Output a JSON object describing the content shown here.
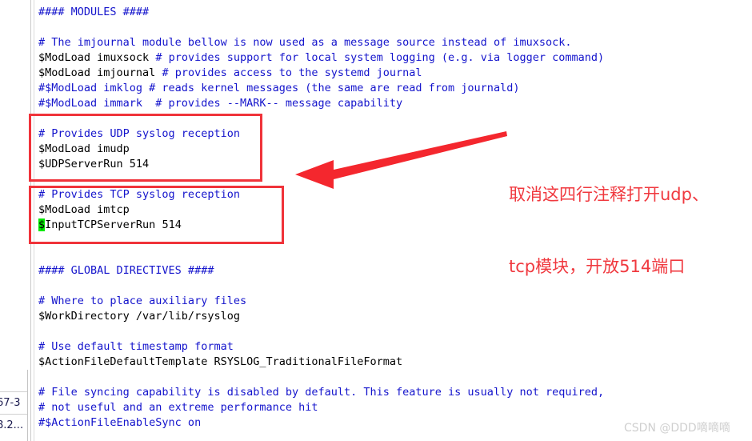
{
  "editor": {
    "file_type": "rsyslog.conf",
    "lines": [
      {
        "text": "#### MODULES ####",
        "kind": "comment"
      },
      {
        "text": "",
        "kind": "blank"
      },
      {
        "text": "# The imjournal module bellow is now used as a message source instead of imuxsock.",
        "kind": "comment"
      },
      {
        "text": "$ModLoad imuxsock # provides support for local system logging (e.g. via logger command)",
        "kind": "mixed",
        "code": "$ModLoad imuxsock ",
        "comment": "# provides support for local system logging (e.g. via logger command)"
      },
      {
        "text": "$ModLoad imjournal # provides access to the systemd journal",
        "kind": "mixed",
        "code": "$ModLoad imjournal ",
        "comment": "# provides access to the systemd journal"
      },
      {
        "text": "#$ModLoad imklog # reads kernel messages (the same are read from journald)",
        "kind": "comment"
      },
      {
        "text": "#$ModLoad immark  # provides --MARK-- message capability",
        "kind": "comment"
      },
      {
        "text": "",
        "kind": "blank"
      },
      {
        "text": "# Provides UDP syslog reception",
        "kind": "comment"
      },
      {
        "text": "$ModLoad imudp",
        "kind": "code"
      },
      {
        "text": "$UDPServerRun 514",
        "kind": "code"
      },
      {
        "text": "",
        "kind": "blank"
      },
      {
        "text": "# Provides TCP syslog reception",
        "kind": "comment"
      },
      {
        "text": "$ModLoad imtcp",
        "kind": "code"
      },
      {
        "text": "$InputTCPServerRun 514",
        "kind": "code-highlighted",
        "highlight_char": "$",
        "rest": "InputTCPServerRun 514"
      },
      {
        "text": "",
        "kind": "blank"
      },
      {
        "text": "",
        "kind": "blank"
      },
      {
        "text": "#### GLOBAL DIRECTIVES ####",
        "kind": "comment"
      },
      {
        "text": "",
        "kind": "blank"
      },
      {
        "text": "# Where to place auxiliary files",
        "kind": "comment"
      },
      {
        "text": "$WorkDirectory /var/lib/rsyslog",
        "kind": "code"
      },
      {
        "text": "",
        "kind": "blank"
      },
      {
        "text": "# Use default timestamp format",
        "kind": "comment"
      },
      {
        "text": "$ActionFileDefaultTemplate RSYSLOG_TraditionalFileFormat",
        "kind": "code"
      },
      {
        "text": "",
        "kind": "blank"
      },
      {
        "text": "# File syncing capability is disabled by default. This feature is usually not required,",
        "kind": "comment"
      },
      {
        "text": "# not useful and an extreme performance hit",
        "kind": "comment"
      },
      {
        "text": "#$ActionFileEnableSync on",
        "kind": "comment"
      }
    ],
    "colors": {
      "comment": "#1414cc",
      "directive": "#000000",
      "cursor_highlight": "#00e800",
      "background": "#ffffff"
    }
  },
  "annotations": {
    "box_udp": {
      "label": "Provides UDP syslog reception block",
      "color": "#f0333a"
    },
    "box_tcp": {
      "label": "Provides TCP syslog reception block",
      "color": "#f0333a"
    },
    "arrow": {
      "label": "arrow pointing to highlighted blocks",
      "color": "#f4272e"
    },
    "note_line_1": "取消这四行注释打开udp、",
    "note_line_2": "tcp模块，开放514端口",
    "note_color": "#f0393f"
  },
  "corner_table": {
    "rows": [
      {
        "value": "67-3"
      },
      {
        "value": "8.2..."
      }
    ]
  },
  "watermark": {
    "text": "CSDN @DDD嘀嘀嘀"
  }
}
